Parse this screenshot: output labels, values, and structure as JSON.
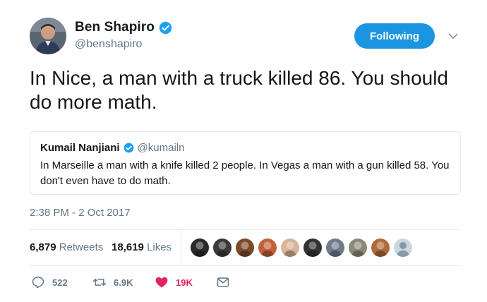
{
  "author": {
    "display_name": "Ben Shapiro",
    "handle": "@benshapiro",
    "verified": true
  },
  "follow_button": {
    "label": "Following",
    "color": "#1b95e0"
  },
  "tweet": {
    "text": "In Nice, a man with a truck killed 86. You should do more math."
  },
  "quoted_tweet": {
    "display_name": "Kumail Nanjiani",
    "handle": "@kumailn",
    "verified": true,
    "text": "In Marseille a man with a knife killed 2 people. In Vegas a man with a gun killed 58. You don't even have to do math."
  },
  "timestamp": "2:38 PM - 2 Oct 2017",
  "stats": {
    "retweets_count": "6,879",
    "retweets_label": "Retweets",
    "likes_count": "18,619",
    "likes_label": "Likes"
  },
  "likers": [
    {
      "icon": "liker-avatar-1",
      "color": "#2a2a2a"
    },
    {
      "icon": "liker-avatar-2",
      "color": "#3b3b3b"
    },
    {
      "icon": "liker-avatar-3",
      "color": "#7a4a2a"
    },
    {
      "icon": "liker-avatar-4",
      "color": "#c2603a"
    },
    {
      "icon": "liker-avatar-5",
      "color": "#d8b49a"
    },
    {
      "icon": "liker-avatar-6",
      "color": "#333333"
    },
    {
      "icon": "liker-avatar-7",
      "color": "#6f7b8a"
    },
    {
      "icon": "liker-avatar-8",
      "color": "#8a8a7a"
    },
    {
      "icon": "liker-avatar-9",
      "color": "#b06a3a"
    },
    {
      "icon": "liker-avatar-default",
      "color": "#ccd6dd"
    }
  ],
  "actions": {
    "reply_count": "522",
    "retweet_count": "6.9K",
    "like_count": "19K"
  },
  "colors": {
    "accent": "#1b95e0",
    "like": "#e0245e",
    "muted": "#657786",
    "verified": "#1da1f2"
  }
}
